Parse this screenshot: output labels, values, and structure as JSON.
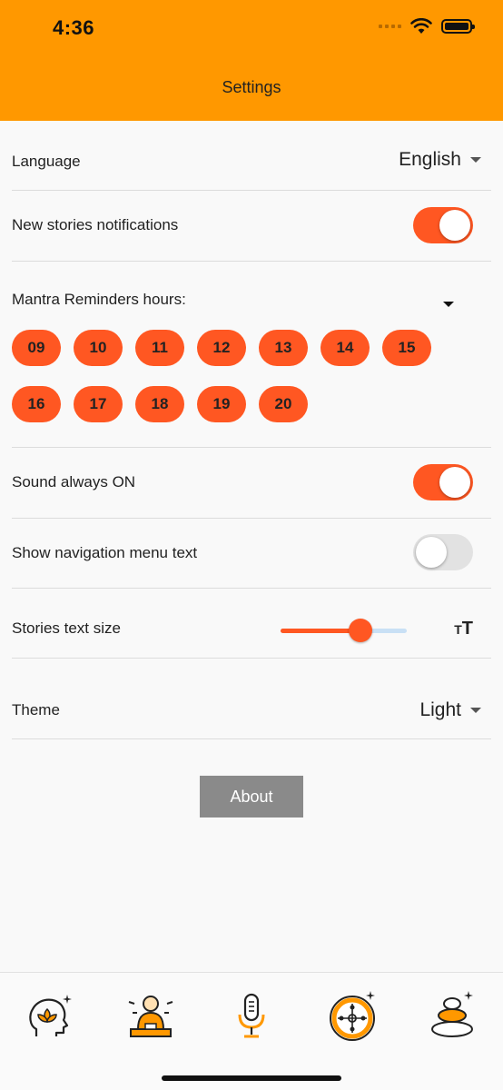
{
  "status_bar": {
    "time": "4:36"
  },
  "header": {
    "title": "Settings",
    "color": "#ff9800"
  },
  "accent_color": "#ff5722",
  "settings": {
    "language": {
      "label": "Language",
      "value": "English"
    },
    "notifications": {
      "label": "New stories notifications",
      "enabled": true
    },
    "mantra": {
      "label": "Mantra Reminders hours:",
      "hours": [
        "09",
        "10",
        "11",
        "12",
        "13",
        "14",
        "15",
        "16",
        "17",
        "18",
        "19",
        "20"
      ]
    },
    "sound": {
      "label": "Sound always ON",
      "enabled": true
    },
    "nav_text": {
      "label": "Show navigation menu text",
      "enabled": false
    },
    "text_size": {
      "label": "Stories text size",
      "level": 0.63,
      "icon": "text-size-icon"
    },
    "theme": {
      "label": "Theme",
      "value": "Light"
    }
  },
  "about_button": {
    "label": "About"
  },
  "bottom_nav": {
    "items": [
      {
        "icon": "mind-lotus-icon"
      },
      {
        "icon": "monk-meditation-icon"
      },
      {
        "icon": "microphone-icon"
      },
      {
        "icon": "wheel-icon"
      },
      {
        "icon": "stacked-stones-icon"
      }
    ]
  }
}
